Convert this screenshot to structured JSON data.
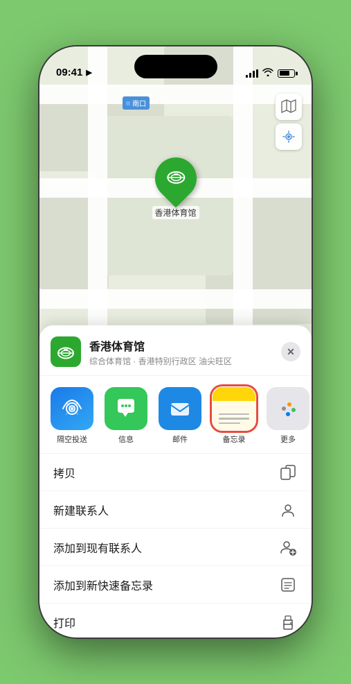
{
  "status": {
    "time": "09:41",
    "location_arrow": "▶"
  },
  "map": {
    "label_text": "南口",
    "stadium_name": "香港体育馆",
    "controls": {
      "map_icon": "🗺",
      "location_icon": "➤"
    }
  },
  "sheet": {
    "title": "香港体育馆",
    "subtitle": "综合体育馆 · 香港特别行政区 油尖旺区",
    "close_label": "✕",
    "apps": [
      {
        "id": "airdrop",
        "label": "隔空投送",
        "emoji": "📡"
      },
      {
        "id": "messages",
        "label": "信息",
        "emoji": "💬"
      },
      {
        "id": "mail",
        "label": "邮件",
        "emoji": "✉️"
      },
      {
        "id": "notes",
        "label": "备忘录",
        "emoji": ""
      }
    ],
    "more_label": "更多",
    "actions": [
      {
        "id": "copy",
        "label": "拷贝",
        "icon": "copy"
      },
      {
        "id": "new-contact",
        "label": "新建联系人",
        "icon": "person"
      },
      {
        "id": "add-contact",
        "label": "添加到现有联系人",
        "icon": "person-add"
      },
      {
        "id": "quick-note",
        "label": "添加到新快速备忘录",
        "icon": "note"
      },
      {
        "id": "print",
        "label": "打印",
        "icon": "printer"
      }
    ]
  }
}
